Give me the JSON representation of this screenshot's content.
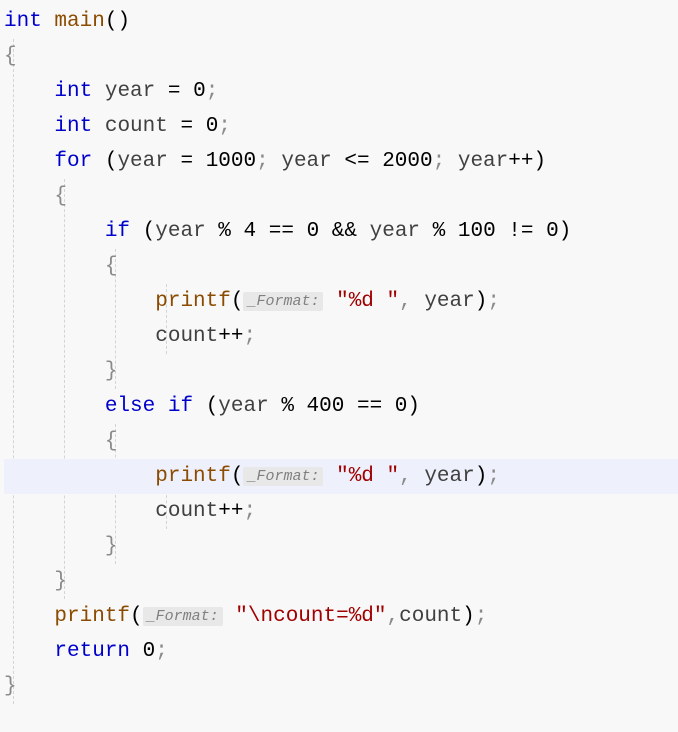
{
  "code": {
    "line1": {
      "kw1": "int",
      "fn": "main",
      "paren": "()"
    },
    "line2": "{",
    "line3": {
      "kw1": "int",
      "id": "year",
      "op": "=",
      "val": "0",
      "semi": ";"
    },
    "line4": {
      "kw1": "int",
      "id": "count",
      "op": "=",
      "val": "0",
      "semi": ";"
    },
    "line5": {
      "kw1": "for",
      "lp": "(",
      "id1": "year",
      "op1": "=",
      "v1": "1000",
      "s1": ";",
      "id2": "year",
      "op2": "<=",
      "v2": "2000",
      "s2": ";",
      "id3": "year",
      "op3": "++",
      "rp": ")"
    },
    "line6": "{",
    "line7": {
      "kw1": "if",
      "lp": "(",
      "id1": "year",
      "op1": "%",
      "v1": "4",
      "op2": "==",
      "v2": "0",
      "op3": "&&",
      "id2": "year",
      "op4": "%",
      "v3": "100",
      "op5": "!=",
      "v4": "0",
      "rp": ")"
    },
    "line8": "{",
    "line9": {
      "fn": "printf",
      "lp": "(",
      "hint": "_Format:",
      "str": "\"%d \"",
      "c": ",",
      "id": "year",
      "rp": ")",
      "semi": ";"
    },
    "line10": {
      "id": "count",
      "op": "++",
      "semi": ";"
    },
    "line11": "}",
    "line12": {
      "kw1": "else",
      "kw2": "if",
      "lp": "(",
      "id": "year",
      "op1": "%",
      "v1": "400",
      "op2": "==",
      "v2": "0",
      "rp": ")"
    },
    "line13": "{",
    "line14": {
      "fn": "printf",
      "lp": "(",
      "hint": "_Format:",
      "str": "\"%d \"",
      "c": ",",
      "id": "year",
      "rp": ")",
      "semi": ";"
    },
    "line15": {
      "id": "count",
      "op": "++",
      "semi": ";"
    },
    "line16": "}",
    "line17": "}",
    "line18": {
      "fn": "printf",
      "lp": "(",
      "hint": "_Format:",
      "str": "\"\\ncount=%d\"",
      "c": ",",
      "id": "count",
      "rp": ")",
      "semi": ";"
    },
    "line19": {
      "kw1": "return",
      "v": "0",
      "semi": ";"
    },
    "line20": "}"
  }
}
